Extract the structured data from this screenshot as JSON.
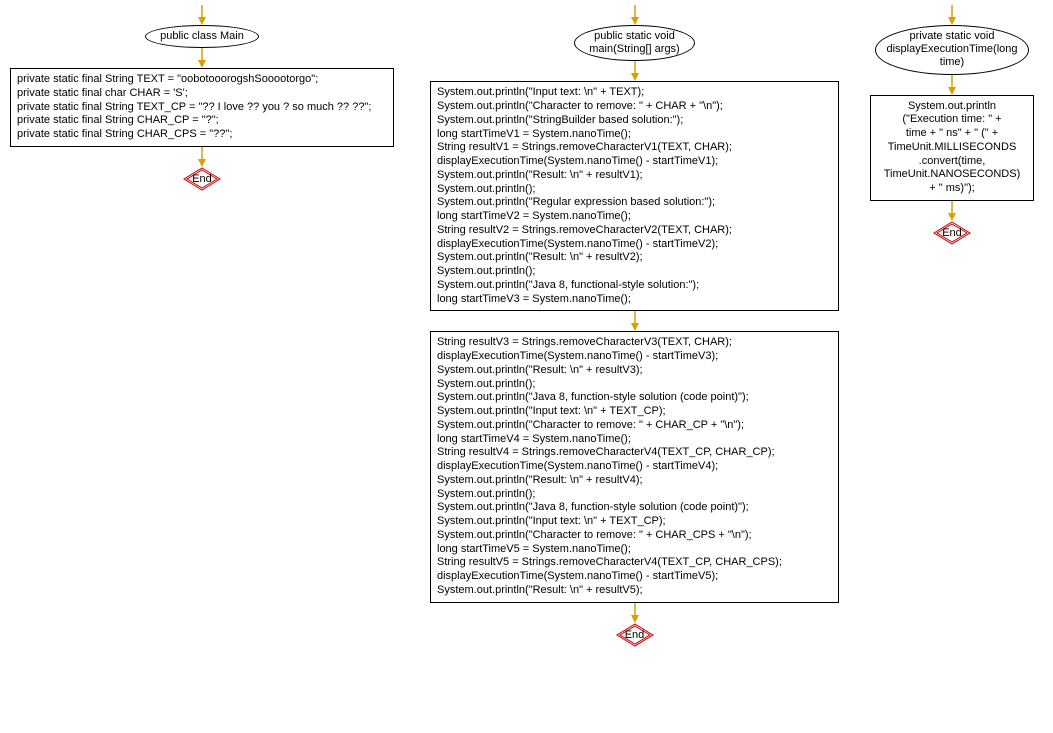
{
  "block1": {
    "header": "public class Main",
    "body": "private static final String TEXT = \"oobotooorogshSooootorgo\";\nprivate static final char CHAR = 'S';\nprivate static final String TEXT_CP = \"?? I love ?? you ? so much ?? ??\";\nprivate static final String CHAR_CP = \"?\";\nprivate static final String CHAR_CPS = \"??\";",
    "end": "End"
  },
  "block2": {
    "header": "public static void\nmain(String[] args)",
    "body": "System.out.println(\"Input text: \\n\" + TEXT);\nSystem.out.println(\"Character to remove: \" + CHAR + \"\\n\");\nSystem.out.println(\"StringBuilder based solution:\");\nlong startTimeV1 = System.nanoTime();\nString resultV1 = Strings.removeCharacterV1(TEXT, CHAR);\ndisplayExecutionTime(System.nanoTime() - startTimeV1);\nSystem.out.println(\"Result: \\n\" + resultV1);\nSystem.out.println();\nSystem.out.println(\"Regular expression based solution:\");\nlong startTimeV2 = System.nanoTime();\nString resultV2 = Strings.removeCharacterV2(TEXT, CHAR);\ndisplayExecutionTime(System.nanoTime() - startTimeV2);\nSystem.out.println(\"Result: \\n\" + resultV2);\nSystem.out.println();\nSystem.out.println(\"Java 8, functional-style solution:\");\nlong startTimeV3 = System.nanoTime();",
    "body2": "String resultV3 = Strings.removeCharacterV3(TEXT, CHAR);\ndisplayExecutionTime(System.nanoTime() - startTimeV3);\nSystem.out.println(\"Result: \\n\" + resultV3);\nSystem.out.println();\nSystem.out.println(\"Java 8, function-style solution (code point)\");\nSystem.out.println(\"Input text: \\n\" + TEXT_CP);\nSystem.out.println(\"Character to remove: \" + CHAR_CP + \"\\n\");\nlong startTimeV4 = System.nanoTime();\nString resultV4 = Strings.removeCharacterV4(TEXT_CP, CHAR_CP);\ndisplayExecutionTime(System.nanoTime() - startTimeV4);\nSystem.out.println(\"Result: \\n\" + resultV4);\nSystem.out.println();\nSystem.out.println(\"Java 8, function-style solution (code point)\");\nSystem.out.println(\"Input text: \\n\" + TEXT_CP);\nSystem.out.println(\"Character to remove: \" + CHAR_CPS + \"\\n\");\nlong startTimeV5 = System.nanoTime();\nString resultV5 = Strings.removeCharacterV4(TEXT_CP, CHAR_CPS);\ndisplayExecutionTime(System.nanoTime() - startTimeV5);\nSystem.out.println(\"Result: \\n\" + resultV5);",
    "end": "End"
  },
  "block3": {
    "header": "private static void\ndisplayExecutionTime(long\ntime)",
    "body": "System.out.println\n(\"Execution time: \" +\ntime + \" ns\" + \" (\" +\nTimeUnit.MILLISECONDS\n.convert(time,\nTimeUnit.NANOSECONDS)\n+ \" ms)\");",
    "end": "End"
  },
  "arrow_color": "#d8a000",
  "diamond_stroke": "#cc0000"
}
